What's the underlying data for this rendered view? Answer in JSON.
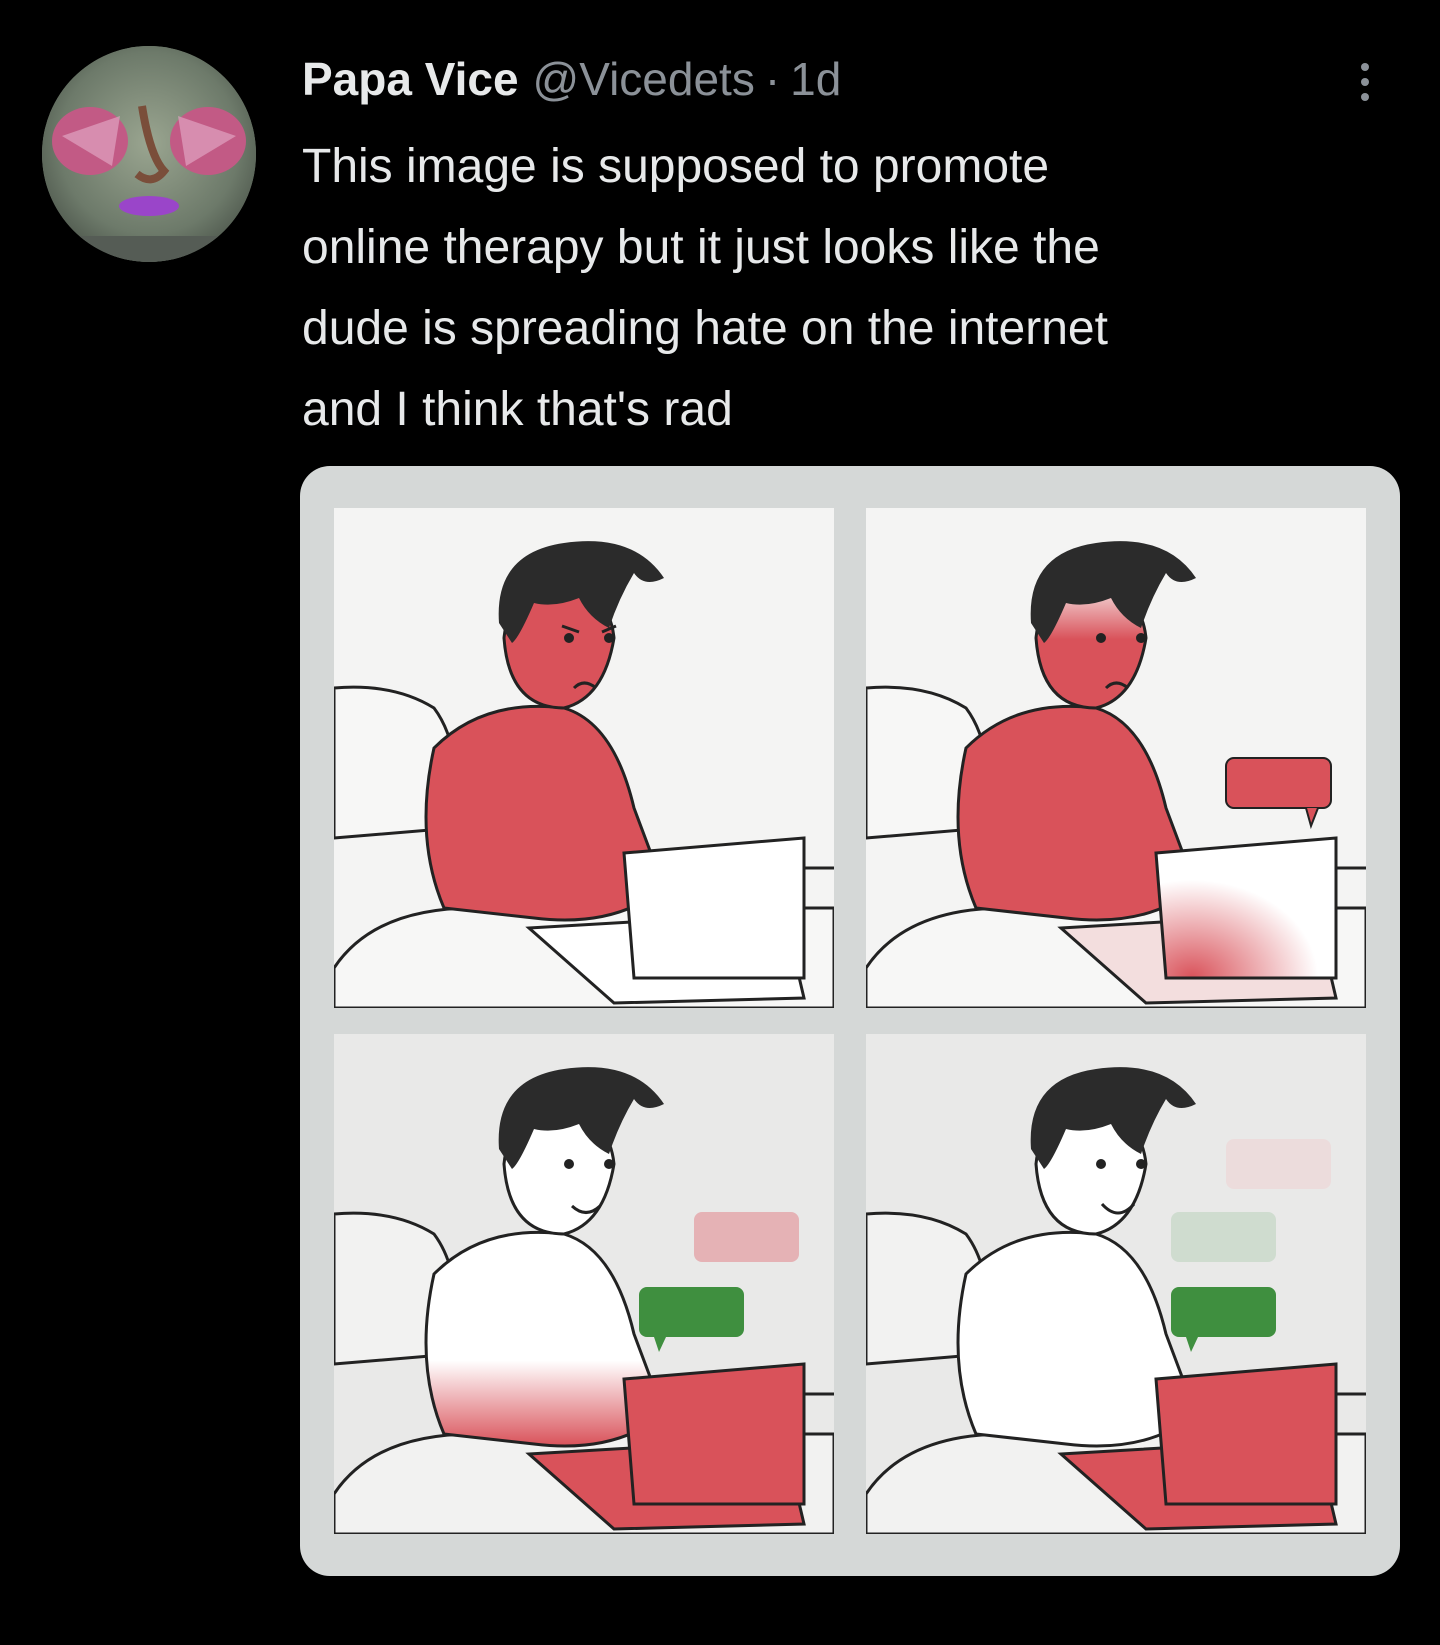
{
  "tweet": {
    "author": {
      "display_name": "Papa Vice",
      "handle": "@Vicedets",
      "separator": "·",
      "time": "1d",
      "avatar_icon": "avatar-clown-face"
    },
    "more_icon": "more-vertical-icon",
    "text": "This image is supposed to promote\nonline therapy but it just looks like the\ndude is spreading hate on the internet\nand I think that's rad",
    "media": {
      "panels": [
        {
          "id": "panel-1",
          "person_color": "red",
          "laptop_color": "white",
          "bubbles": []
        },
        {
          "id": "panel-2",
          "person_color": "red-fading",
          "laptop_color": "white-red-tint",
          "bubbles": [
            "red"
          ]
        },
        {
          "id": "panel-3",
          "person_color": "white-red-bottom",
          "laptop_color": "red",
          "bubbles": [
            "pink",
            "green"
          ]
        },
        {
          "id": "panel-4",
          "person_color": "white",
          "laptop_color": "red",
          "bubbles": [
            "faint-pink",
            "faint-green",
            "green"
          ]
        }
      ]
    },
    "colors": {
      "background": "#000000",
      "text": "#e7e9ea",
      "muted": "#8b9198",
      "red": "#d9525a",
      "green": "#3f8f3f"
    }
  }
}
